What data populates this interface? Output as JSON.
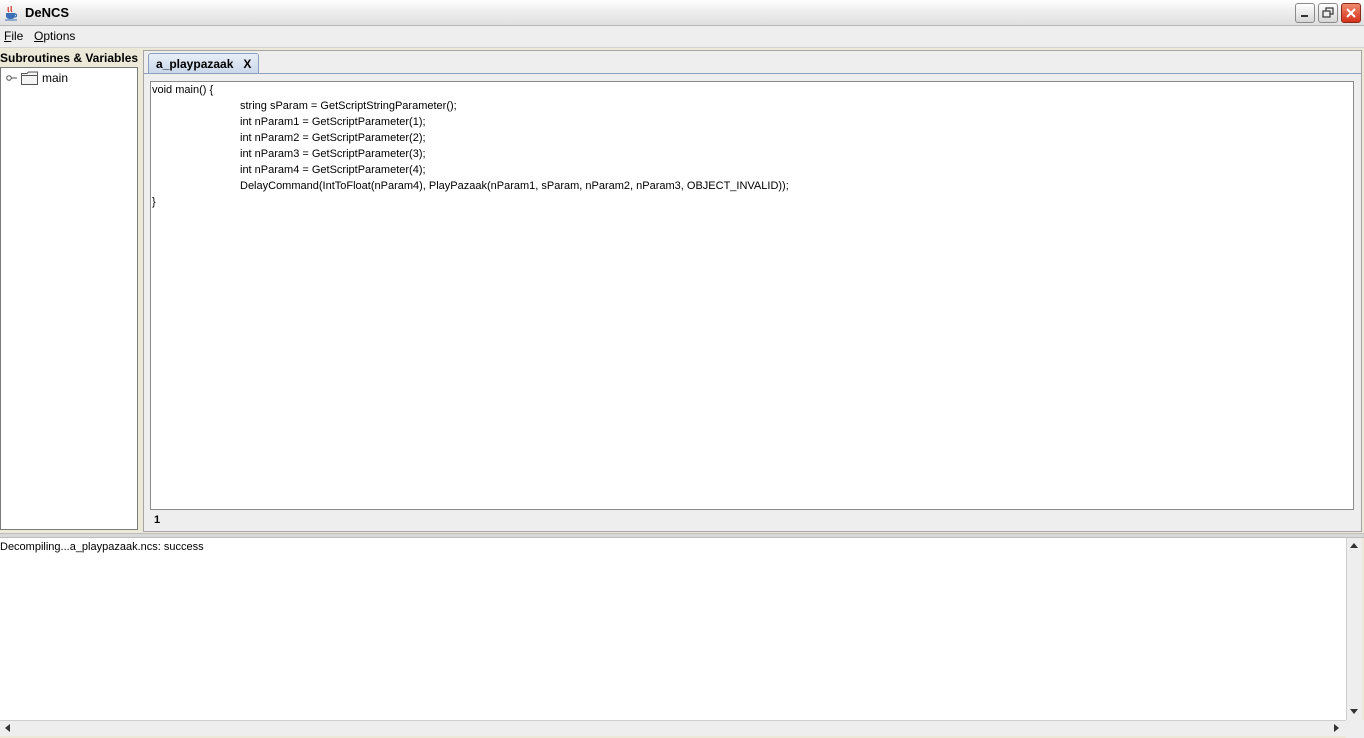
{
  "window": {
    "title": "DeNCS",
    "icon": "java-cup-icon",
    "controls": [
      "minimize-icon",
      "restore-icon",
      "close-icon"
    ]
  },
  "menu": {
    "file": {
      "mnemonic": "F",
      "rest": "ile"
    },
    "options": {
      "mnemonic": "O",
      "rest": "ptions"
    }
  },
  "sidebar": {
    "title": "Subroutines & Variables",
    "tree": [
      {
        "label": "main",
        "icon": "folder-icon",
        "toggle": "tree-expander-icon"
      }
    ]
  },
  "editor": {
    "tab": {
      "label": "a_playpazaak",
      "close_label": "X"
    },
    "code_lines": [
      "void main() {",
      "\t\t\tstring sParam = GetScriptStringParameter();",
      "\t\t\tint nParam1 = GetScriptParameter(1);",
      "\t\t\tint nParam2 = GetScriptParameter(2);",
      "\t\t\tint nParam3 = GetScriptParameter(3);",
      "\t\t\tint nParam4 = GetScriptParameter(4);",
      "\t\t\tDelayCommand(IntToFloat(nParam4), PlayPazaak(nParam1, sParam, nParam2, nParam3, OBJECT_INVALID));",
      "}"
    ],
    "current_line": "1"
  },
  "log": {
    "text": "Decompiling...a_playpazaak.ncs: success"
  }
}
